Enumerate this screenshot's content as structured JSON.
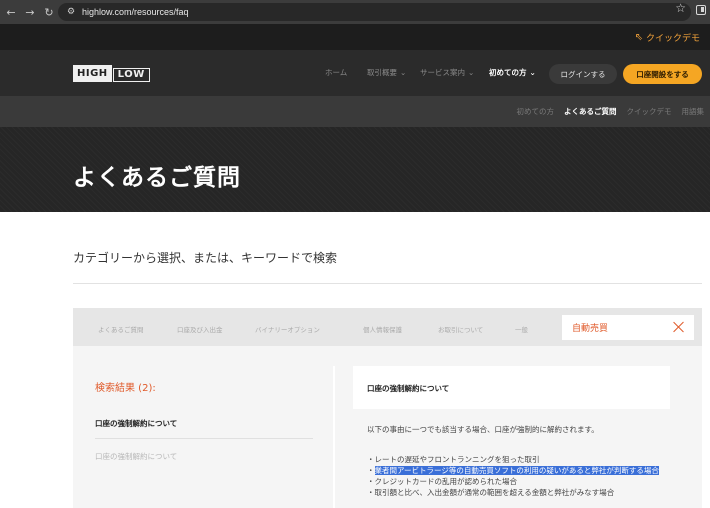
{
  "browser": {
    "url": "highlow.com/resources/faq"
  },
  "topbar": {
    "quick_demo": "クイックデモ"
  },
  "header": {
    "logo_high": "HIGH",
    "logo_low": "LOW",
    "nav": [
      {
        "label": "ホーム"
      },
      {
        "label": "取引概要"
      },
      {
        "label": "サービス案内"
      },
      {
        "label": "初めての方"
      }
    ],
    "login_label": "ログインする",
    "signup_label": "口座開設をする"
  },
  "subnav": {
    "items": [
      "初めての方",
      "よくあるご質問",
      "クイックデモ",
      "用語集"
    ]
  },
  "hero": {
    "title": "よくあるご質問"
  },
  "search": {
    "heading": "カテゴリーから選択、または、キーワードで検索",
    "categories": [
      "よくあるご質問",
      "口座及び入出金",
      "バイナリーオプション",
      "個人情報保護",
      "お取引について",
      "一般"
    ],
    "query": "自動売買"
  },
  "results": {
    "title": "検索結果 (2):",
    "items": [
      "口座の強制解約について",
      "口座の強制解約について"
    ]
  },
  "answer": {
    "question": "口座の強制解約について",
    "intro": "以下の事由に一つでも該当する場合、口座が強制的に解約されます。",
    "bullets": [
      "・レートの遅延やフロントランニングを狙った取引",
      "業者間アービトラージ等の自動売買ソフトの利用の疑いがあると弊社が判断する場合",
      "・クレジットカードの乱用が認められた場合",
      "・取引額と比べ、入出金額が通常の範囲を超える金額と弊社がみなす場合"
    ]
  },
  "colors": {
    "accent_orange": "#f5a623",
    "result_red": "#e05a2a",
    "highlight_blue": "#3a6fd8"
  }
}
